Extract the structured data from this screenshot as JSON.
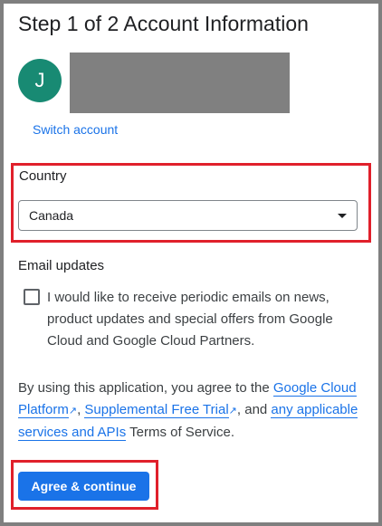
{
  "header": {
    "step": "Step 1 of 2",
    "title": "Account Information"
  },
  "account": {
    "avatar_initial": "J",
    "switch_label": "Switch account"
  },
  "country": {
    "label": "Country",
    "value": "Canada"
  },
  "email": {
    "label": "Email updates",
    "checked": false,
    "checkbox_text": "I would like to receive periodic emails on news, product updates and special offers from Google Cloud and Google Cloud Partners."
  },
  "terms": {
    "prefix": "By using this application, you agree to the ",
    "link1": "Google Cloud Platform",
    "sep1": ", ",
    "link2": "Supplemental Free Trial",
    "sep2": ", and ",
    "link3": "any applicable services and APIs",
    "suffix": " Terms of Service.",
    "ext_icon": "↗"
  },
  "actions": {
    "agree_label": "Agree & continue"
  },
  "colors": {
    "accent": "#1a73e8",
    "highlight": "#e0202b",
    "avatar": "#188a73"
  }
}
